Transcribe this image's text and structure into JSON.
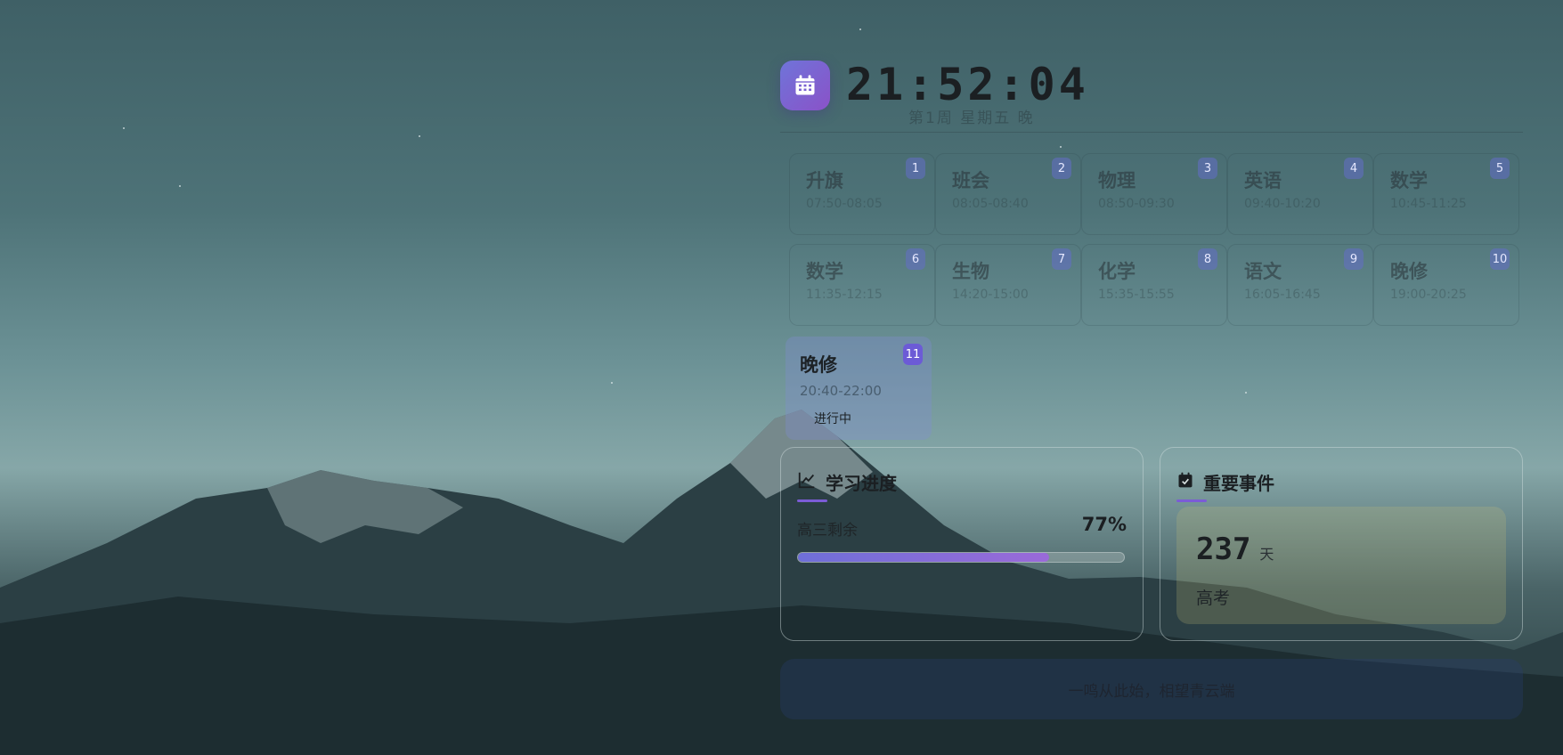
{
  "clock": {
    "time": "21:52:04",
    "date": "第1周 星期五 晚"
  },
  "schedule": [
    {
      "index": "1",
      "subject": "升旗",
      "time": "07:50-08:05"
    },
    {
      "index": "2",
      "subject": "班会",
      "time": "08:05-08:40"
    },
    {
      "index": "3",
      "subject": "物理",
      "time": "08:50-09:30"
    },
    {
      "index": "4",
      "subject": "英语",
      "time": "09:40-10:20"
    },
    {
      "index": "5",
      "subject": "数学",
      "time": "10:45-11:25"
    },
    {
      "index": "6",
      "subject": "数学",
      "time": "11:35-12:15"
    },
    {
      "index": "7",
      "subject": "生物",
      "time": "14:20-15:00"
    },
    {
      "index": "8",
      "subject": "化学",
      "time": "15:35-15:55"
    },
    {
      "index": "9",
      "subject": "语文",
      "time": "16:05-16:45"
    },
    {
      "index": "10",
      "subject": "晚修",
      "time": "19:00-20:25"
    },
    {
      "index": "11",
      "subject": "晚修",
      "time": "20:40-22:00",
      "status": "进行中"
    }
  ],
  "progress": {
    "title": "学习进度",
    "label": "高三剩余",
    "value_text": "77%",
    "value": 0.77
  },
  "events": {
    "title": "重要事件",
    "days": "237",
    "unit": "天",
    "name": "高考"
  },
  "quote": "一鸣从此始，相望青云端",
  "colors": {
    "accent": "#6c5bd6",
    "progress_start": "#6f6fd8",
    "progress_end": "#9a6ad8"
  }
}
